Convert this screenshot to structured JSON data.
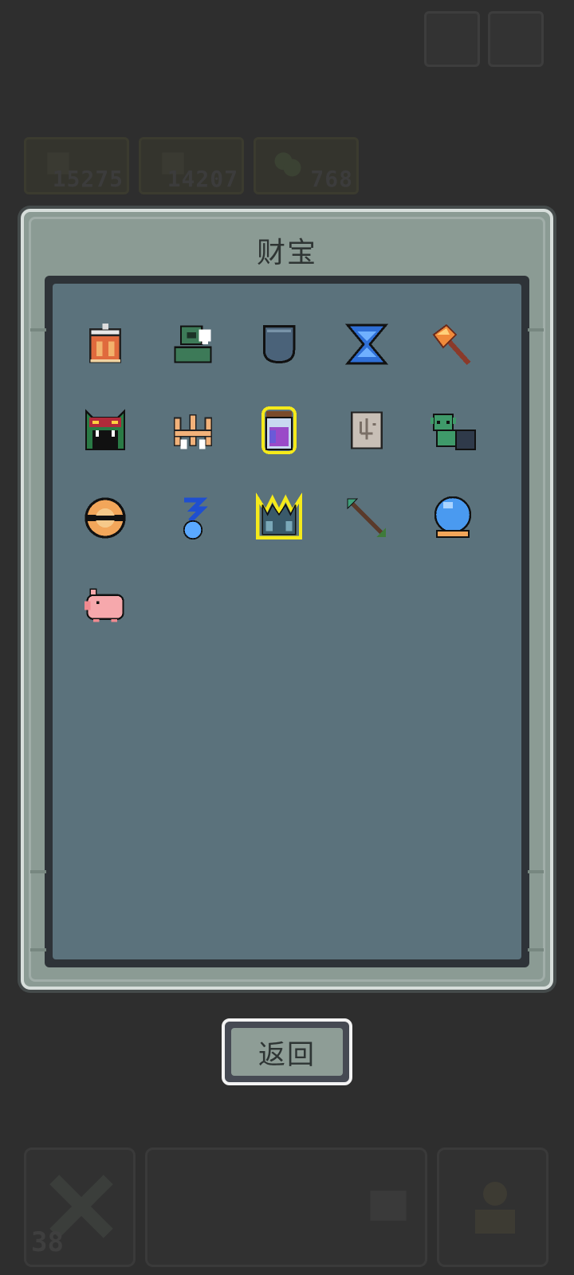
{
  "background_hud": {
    "resources": [
      {
        "icon": "wood-log-icon",
        "value": "15275"
      },
      {
        "icon": "ore-icon",
        "value": "14207"
      },
      {
        "icon": "herb-icon",
        "value": "768"
      }
    ],
    "level": "38",
    "top_buttons": [
      "settings-icon",
      "map-icon"
    ]
  },
  "treasure_panel": {
    "title": "财宝",
    "items": [
      {
        "name": "treasure-drum",
        "icon": "drum-icon",
        "highlighted": false
      },
      {
        "name": "treasure-green-helmet",
        "icon": "helmet-icon",
        "highlighted": false
      },
      {
        "name": "treasure-iron-shield",
        "icon": "shield-icon",
        "highlighted": false
      },
      {
        "name": "treasure-hourglass",
        "icon": "hourglass-icon",
        "highlighted": false
      },
      {
        "name": "treasure-battle-axe",
        "icon": "axe-icon",
        "highlighted": false
      },
      {
        "name": "treasure-demon-mask",
        "icon": "demon-mask-icon",
        "highlighted": false
      },
      {
        "name": "treasure-crown",
        "icon": "crown-icon",
        "highlighted": false
      },
      {
        "name": "treasure-potion-jar",
        "icon": "potion-jar-icon",
        "highlighted": true
      },
      {
        "name": "treasure-old-map",
        "icon": "scroll-map-icon",
        "highlighted": false
      },
      {
        "name": "treasure-goblin-sack",
        "icon": "goblin-icon",
        "highlighted": false
      },
      {
        "name": "treasure-orb-ring",
        "icon": "ring-orb-icon",
        "highlighted": false
      },
      {
        "name": "treasure-blue-spirit",
        "icon": "spirit-icon",
        "highlighted": false
      },
      {
        "name": "treasure-spiked-crown",
        "icon": "spiked-crown-icon",
        "highlighted": true
      },
      {
        "name": "treasure-arrow",
        "icon": "arrow-icon",
        "highlighted": false
      },
      {
        "name": "treasure-crystal-ball",
        "icon": "crystal-ball-icon",
        "highlighted": false
      },
      {
        "name": "treasure-piggy",
        "icon": "piggy-icon",
        "highlighted": false
      }
    ]
  },
  "back_button": {
    "label": "返回"
  },
  "colors": {
    "background": "#2e2e2e",
    "panel": "#8b9b94",
    "grid": "#5b727c",
    "highlight": "#f5ea1a"
  }
}
